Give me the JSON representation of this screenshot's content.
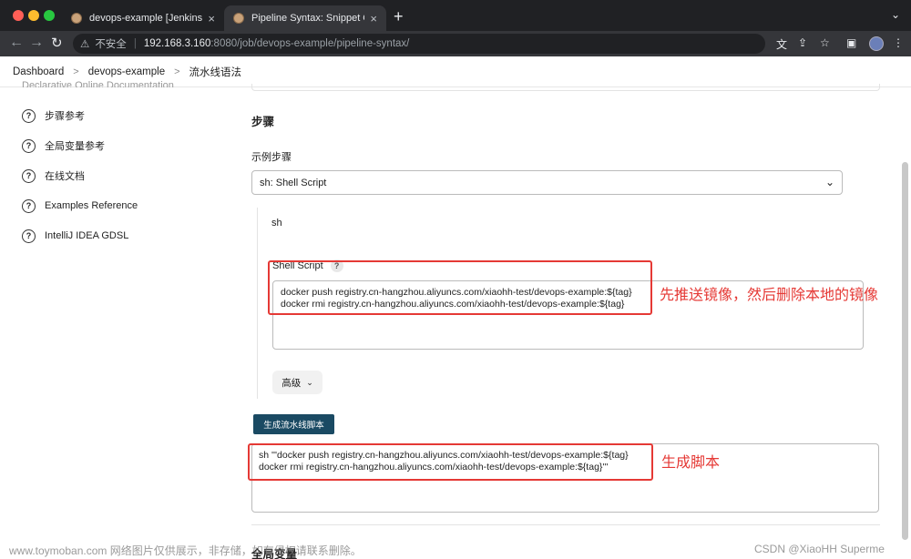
{
  "browser": {
    "tabs": [
      {
        "title": "devops-example [Jenkins]"
      },
      {
        "title": "Pipeline Syntax: Snippet Gene"
      }
    ],
    "url": {
      "security_label": "不安全",
      "host": "192.168.3.160",
      "path": ":8080/job/devops-example/pipeline-syntax/"
    }
  },
  "breadcrumb": [
    "Dashboard",
    "devops-example",
    "流水线语法"
  ],
  "sidebar": {
    "partial_item": "Declarative Online Documentation",
    "items": [
      {
        "label": "步骤参考"
      },
      {
        "label": "全局变量参考"
      },
      {
        "label": "在线文档"
      },
      {
        "label": "Examples Reference"
      },
      {
        "label": "IntelliJ IDEA GDSL"
      }
    ]
  },
  "main": {
    "section_title": "步骤",
    "sample_step_label": "示例步骤",
    "sample_step_value": "sh: Shell Script",
    "step_name": "sh",
    "shell_script_label": "Shell Script",
    "shell_script_help": "?",
    "script_lines": [
      "docker push registry.cn-hangzhou.aliyuncs.com/xiaohh-test/devops-example:${tag}",
      "docker rmi registry.cn-hangzhou.aliyuncs.com/xiaohh-test/devops-example:${tag}"
    ],
    "advanced_label": "高级",
    "generate_button": "生成流水线脚本",
    "output_lines": [
      "sh '''docker push registry.cn-hangzhou.aliyuncs.com/xiaohh-test/devops-example:${tag}",
      "docker rmi registry.cn-hangzhou.aliyuncs.com/xiaohh-test/devops-example:${tag}'''"
    ],
    "next_section_title": "全局变量"
  },
  "annotations": {
    "script_note": "先推送镜像，然后删除本地的镜像",
    "output_note": "生成脚本",
    "color": "#e53935"
  },
  "watermarks": {
    "left": "www.toymoban.com 网络图片仅供展示，非存储，如有侵权请联系删除。",
    "right": "CSDN @XiaoHH Superme"
  }
}
